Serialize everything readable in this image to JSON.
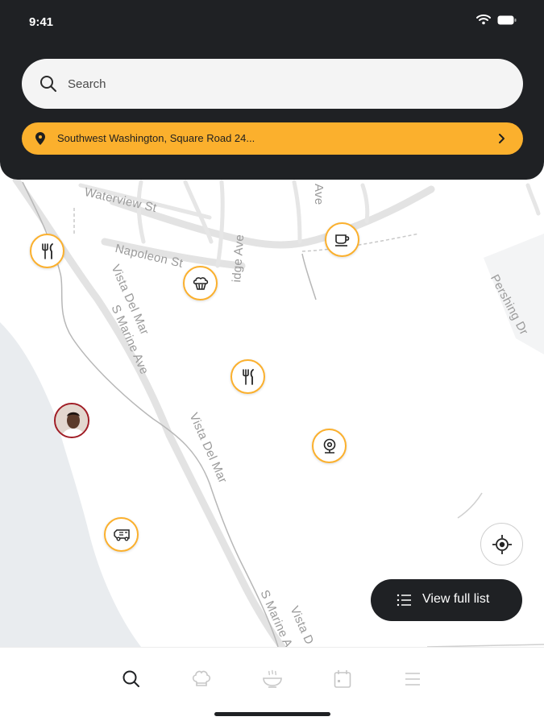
{
  "status_bar": {
    "time": "9:41",
    "icons": [
      "wifi-icon",
      "battery-icon"
    ]
  },
  "search": {
    "placeholder": "Search",
    "icon": "search-icon"
  },
  "location_bar": {
    "text": "Southwest Washington, Square Road 24...",
    "icon": "location-pin-icon",
    "chevron": "chevron-right-icon"
  },
  "map": {
    "street_labels": [
      "Waterview St",
      "Napoleon St",
      "Vista Del Mar",
      "S Marine Ave",
      "Vista Del Mar",
      "Pershing Dr",
      "Ave",
      "idge Ave",
      "S Marine A",
      "Vista D"
    ],
    "markers": [
      {
        "type": "restaurant",
        "icon": "fork-knife-icon"
      },
      {
        "type": "bakery",
        "icon": "muffin-icon"
      },
      {
        "type": "cafe",
        "icon": "coffee-cup-icon"
      },
      {
        "type": "restaurant",
        "icon": "fork-knife-icon"
      },
      {
        "type": "webcam",
        "icon": "webcam-icon"
      },
      {
        "type": "food-truck",
        "icon": "food-truck-icon"
      },
      {
        "type": "user",
        "icon": "user-avatar"
      }
    ]
  },
  "actions": {
    "view_full_list": "View full list",
    "locate_icon": "crosshair-icon"
  },
  "tab_bar": {
    "tabs": [
      {
        "name": "search",
        "icon": "search-icon",
        "active": true
      },
      {
        "name": "chef",
        "icon": "chef-hat-icon",
        "active": false
      },
      {
        "name": "dish",
        "icon": "bowl-icon",
        "active": false
      },
      {
        "name": "calendar",
        "icon": "calendar-icon",
        "active": false
      },
      {
        "name": "menu",
        "icon": "menu-icon",
        "active": false
      }
    ]
  },
  "colors": {
    "header_bg": "#1f2124",
    "accent": "#fbb02d",
    "avatar_ring": "#a01c25",
    "water": "#e9ecef",
    "road": "#e2e2e2"
  }
}
